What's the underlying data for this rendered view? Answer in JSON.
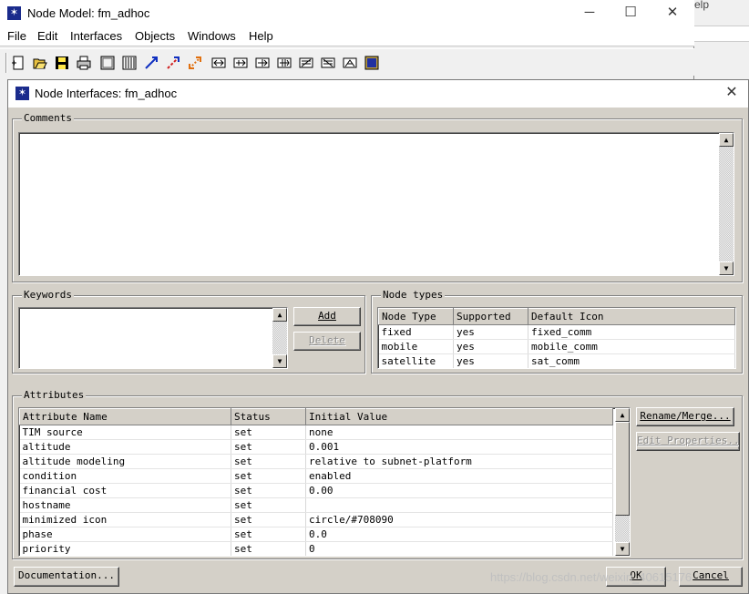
{
  "main_window": {
    "title": "Node Model: fm_adhoc",
    "menu": [
      "File",
      "Edit",
      "Interfaces",
      "Objects",
      "Windows",
      "Help"
    ],
    "toolbar_icons": [
      "new-icon",
      "open-icon",
      "save-icon",
      "print-icon",
      "module-icon",
      "module-array-icon",
      "packet-stream-icon",
      "statistic-wire-icon",
      "logical-tx-rx-icon",
      "create-processor-icon",
      "create-queue-icon",
      "create-tx-icon",
      "create-rx-icon",
      "create-radio-tx-icon",
      "create-radio-rx-icon",
      "create-antenna-icon",
      "end-editing-icon"
    ]
  },
  "background_window": {
    "partial_menu_text": "elp"
  },
  "dialog": {
    "title": "Node Interfaces: fm_adhoc",
    "comments": {
      "label": "Comments",
      "text": ""
    },
    "keywords": {
      "label": "Keywords",
      "add_label": "Add",
      "delete_label": "Delete"
    },
    "node_types": {
      "label": "Node types",
      "columns": [
        "Node Type",
        "Supported",
        "Default Icon"
      ],
      "rows": [
        [
          "fixed",
          "yes",
          "fixed_comm"
        ],
        [
          "mobile",
          "yes",
          "mobile_comm"
        ],
        [
          "satellite",
          "yes",
          "sat_comm"
        ]
      ]
    },
    "attributes": {
      "label": "Attributes",
      "columns": [
        "Attribute Name",
        "Status",
        "Initial Value"
      ],
      "rows": [
        [
          "TIM source",
          "set",
          "none"
        ],
        [
          "altitude",
          "set",
          "0.001"
        ],
        [
          "altitude modeling",
          "set",
          "relative to subnet-platform"
        ],
        [
          "condition",
          "set",
          "enabled"
        ],
        [
          "financial cost",
          "set",
          "0.00"
        ],
        [
          "hostname",
          "set",
          ""
        ],
        [
          "minimized icon",
          "set",
          "circle/#708090"
        ],
        [
          "phase",
          "set",
          "0.0"
        ],
        [
          "priority",
          "set",
          "0"
        ]
      ],
      "rename_label": "Rename/Merge...",
      "edit_props_label": "Edit Properties..."
    },
    "documentation_label": "Documentation...",
    "ok_label": "OK",
    "cancel_label": "Cancel"
  },
  "watermark": "https://blog.csdn.net/weixin_40615176"
}
